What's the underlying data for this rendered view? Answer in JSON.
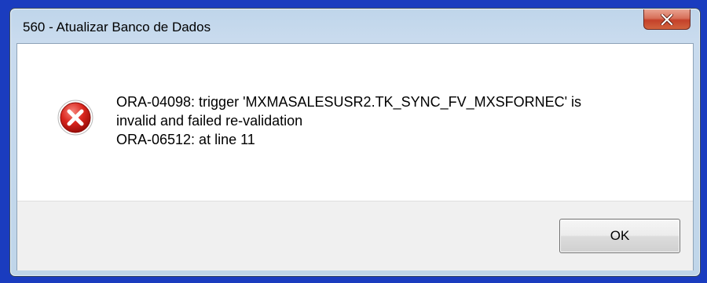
{
  "window": {
    "title": "560 - Atualizar Banco de Dados",
    "close_icon": "close-icon"
  },
  "message": {
    "icon": "error-icon",
    "text": "ORA-04098: trigger 'MXMASALESUSR2.TK_SYNC_FV_MXSFORNEC' is\ninvalid and failed re-validation\nORA-06512: at line 11"
  },
  "buttons": {
    "ok_label": "OK"
  },
  "colors": {
    "background_frame": "#1a3cbf",
    "error_red": "#c8102e",
    "close_button_red": "#c4412a"
  }
}
